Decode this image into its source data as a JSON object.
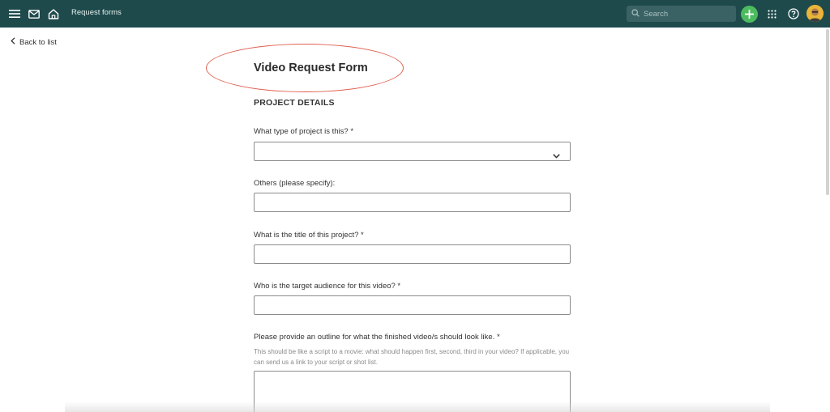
{
  "topbar": {
    "breadcrumb": "Request forms",
    "search_placeholder": "Search",
    "icons": [
      "menu-icon",
      "mail-icon",
      "home-icon",
      "search-icon",
      "plus-icon",
      "apps-grid-icon",
      "help-icon",
      "avatar"
    ]
  },
  "nav": {
    "back_label": "Back to list"
  },
  "form": {
    "title": "Video Request Form",
    "section_heading": "PROJECT DETAILS",
    "q_project_type": "What type of project is this? *",
    "q_others": "Others (please specify):",
    "q_title": "What is the title of this project? *",
    "q_audience": "Who is the target audience for this video? *",
    "q_outline": "Please provide an outline for what the finished video/s should look like.  *",
    "outline_help": "This should be like a script to a movie: what should happen first, second, third in your video? If applicable, you can send us a link to your script or shot list."
  },
  "colors": {
    "topbar": "#1e4a4c",
    "accent_green": "#4cbb5f",
    "annotation_red": "#e06150"
  }
}
